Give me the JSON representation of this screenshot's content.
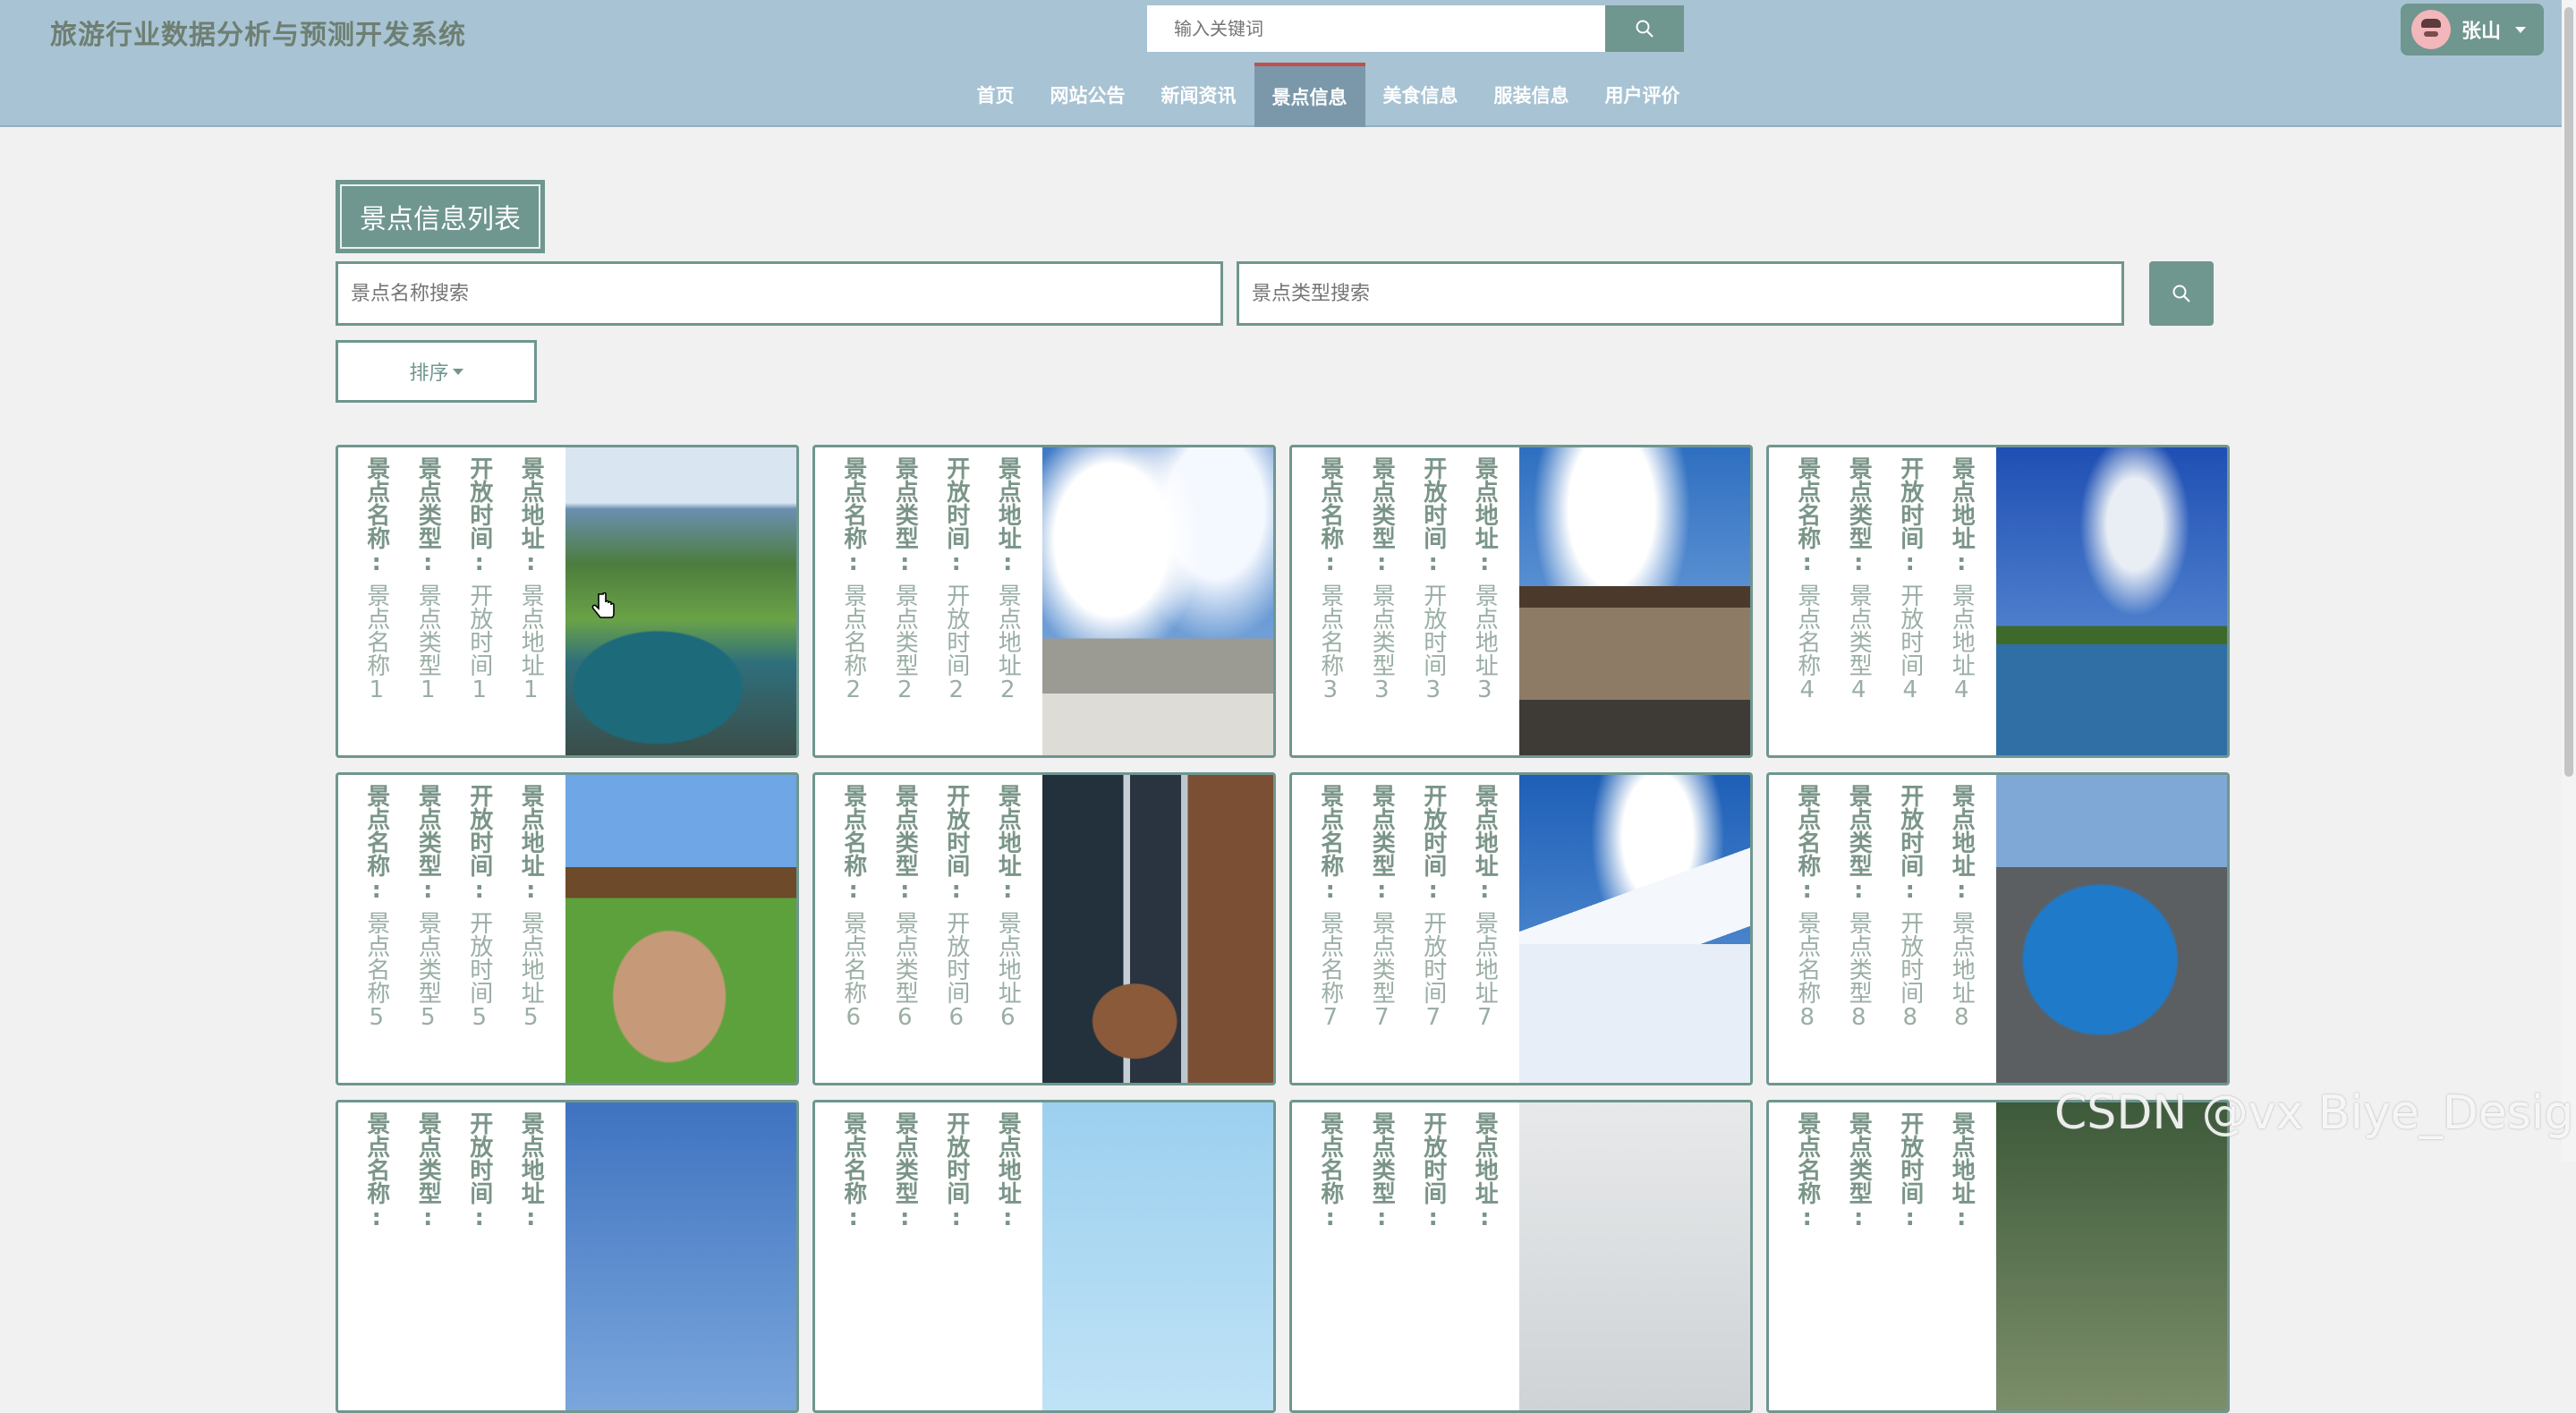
{
  "header": {
    "brand": "旅游行业数据分析与预测开发系统",
    "search_placeholder": "输入关键词",
    "user_name": "张山"
  },
  "nav": {
    "items": [
      "首页",
      "网站公告",
      "新闻资讯",
      "景点信息",
      "美食信息",
      "服装信息",
      "用户评价"
    ],
    "active": "景点信息"
  },
  "main": {
    "title": "景点信息列表",
    "name_search_placeholder": "景点名称搜索",
    "type_search_placeholder": "景点类型搜索",
    "sort_label": "排序"
  },
  "cards": [
    {
      "labels": [
        "景点名称:",
        "景点类型:",
        "开放时间:",
        "景点地址:"
      ],
      "values": [
        "景点名称1",
        "景点类型1",
        "开放时间1",
        "景点地址1"
      ],
      "image": "karst-river-landscape"
    },
    {
      "labels": [
        "景点名称:",
        "景点类型:",
        "开放时间:",
        "景点地址:"
      ],
      "values": [
        "景点名称2",
        "景点类型2",
        "开放时间2",
        "景点地址2"
      ],
      "image": "temple-gate-clouds"
    },
    {
      "labels": [
        "景点名称:",
        "景点类型:",
        "开放时间:",
        "景点地址:"
      ],
      "values": [
        "景点名称3",
        "景点类型3",
        "开放时间3",
        "景点地址3"
      ],
      "image": "ancient-city-gate"
    },
    {
      "labels": [
        "景点名称:",
        "景点类型:",
        "开放时间:",
        "景点地址:"
      ],
      "values": [
        "景点名称4",
        "景点类型4",
        "开放时间4",
        "景点地址4"
      ],
      "image": "three-pagodas-lake"
    },
    {
      "labels": [
        "景点名称:",
        "景点类型:",
        "开放时间:",
        "景点地址:"
      ],
      "values": [
        "景点名称5",
        "景点类型5",
        "开放时间5",
        "景点地址5"
      ],
      "image": "pavilion-rock-garden"
    },
    {
      "labels": [
        "景点名称:",
        "景点类型:",
        "开放时间:",
        "景点地址:"
      ],
      "values": [
        "景点名称6",
        "景点类型6",
        "开放时间6",
        "景点地址6"
      ],
      "image": "waterfall-rocks"
    },
    {
      "labels": [
        "景点名称:",
        "景点类型:",
        "开放时间:",
        "景点地址:"
      ],
      "values": [
        "景点名称7",
        "景点类型7",
        "开放时间7",
        "景点地址7"
      ],
      "image": "snow-mountain-boardwalk"
    },
    {
      "labels": [
        "景点名称:",
        "景点类型:",
        "开放时间:",
        "景点地址:"
      ],
      "values": [
        "景点名称8",
        "景点类型8",
        "开放时间8",
        "景点地址8"
      ],
      "image": "crater-lake"
    },
    {
      "labels": [
        "景点名称:",
        "景点类型:",
        "开放时间:",
        "景点地址:"
      ],
      "values": [
        "",
        "",
        "",
        ""
      ],
      "image": "sky"
    },
    {
      "labels": [
        "景点名称:",
        "景点类型:",
        "开放时间:",
        "景点地址:"
      ],
      "values": [
        "",
        "",
        "",
        ""
      ],
      "image": "sky"
    },
    {
      "labels": [
        "景点名称:",
        "景点类型:",
        "开放时间:",
        "景点地址:"
      ],
      "values": [
        "",
        "",
        "",
        ""
      ],
      "image": "snow"
    },
    {
      "labels": [
        "景点名称:",
        "景点类型:",
        "开放时间:",
        "景点地址:"
      ],
      "values": [
        "",
        "",
        "",
        ""
      ],
      "image": "forest"
    }
  ],
  "watermark": "CSDN @vx Biye_Design",
  "colors": {
    "nav": "#a8c3d3",
    "accent": "#6f968f",
    "active_tab": "#7b98aa"
  }
}
